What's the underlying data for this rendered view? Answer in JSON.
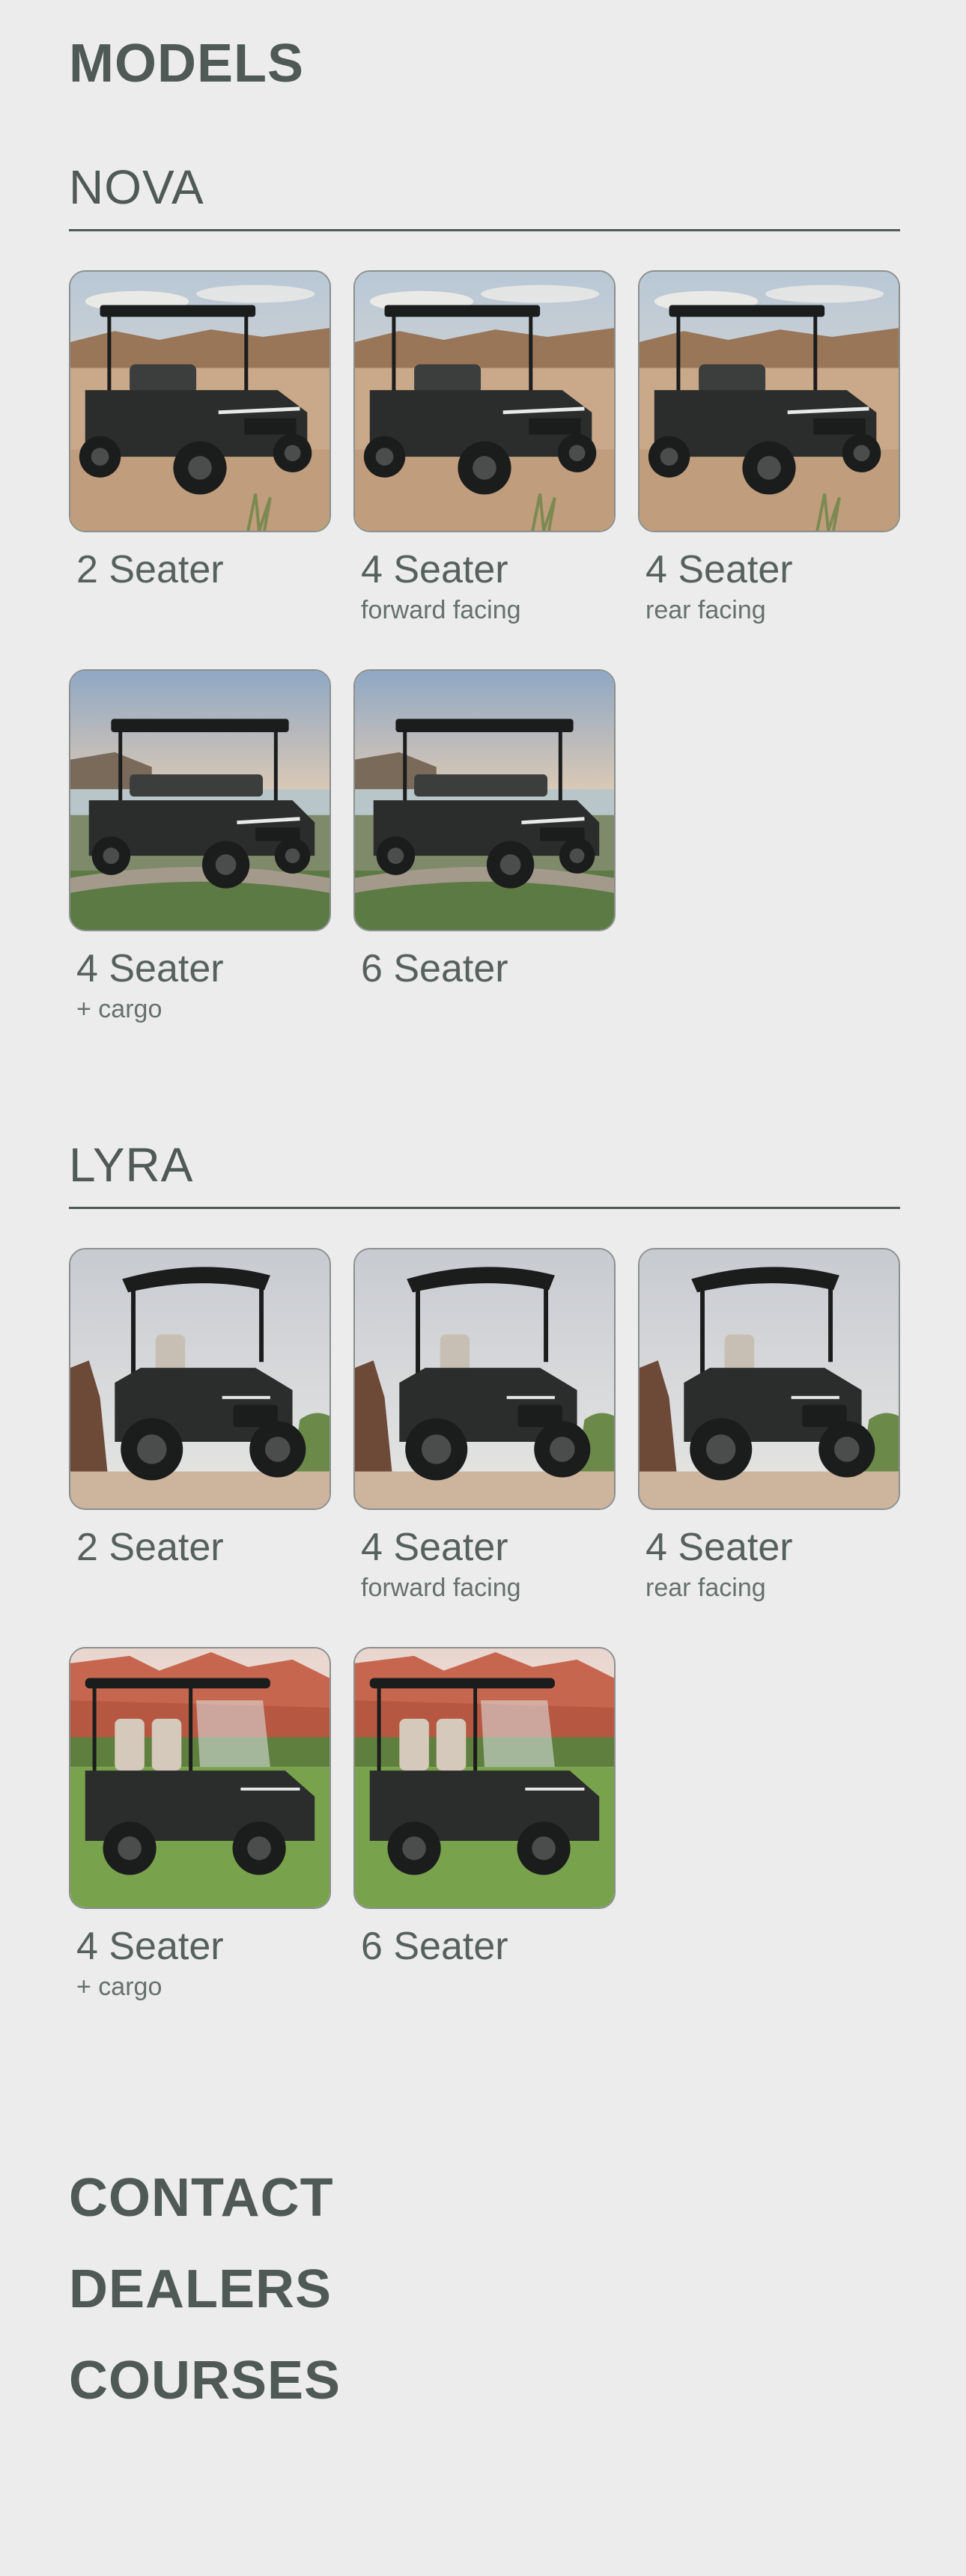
{
  "page": {
    "title": "MODELS"
  },
  "sections": [
    {
      "name": "NOVA",
      "scene": "desert",
      "models": [
        {
          "label": "2 Seater",
          "sub": ""
        },
        {
          "label": "4 Seater",
          "sub": "forward facing"
        },
        {
          "label": "4 Seater",
          "sub": "rear facing"
        },
        {
          "label": "4 Seater",
          "sub": "+ cargo",
          "scene": "coast"
        },
        {
          "label": "6 Seater",
          "sub": "",
          "scene": "coast"
        }
      ]
    },
    {
      "name": "LYRA",
      "scene": "rock",
      "models": [
        {
          "label": "2 Seater",
          "sub": ""
        },
        {
          "label": "4 Seater",
          "sub": "forward facing"
        },
        {
          "label": "4 Seater",
          "sub": "rear facing"
        },
        {
          "label": "4 Seater",
          "sub": "+ cargo",
          "scene": "canyon"
        },
        {
          "label": "6 Seater",
          "sub": "",
          "scene": "canyon"
        }
      ]
    }
  ],
  "nav": {
    "contact": "CONTACT",
    "dealers": "DEALERS",
    "courses": "COURSES"
  },
  "colors": {
    "text": "#4f5956",
    "background": "#ececec",
    "cart": "#2b2d2c"
  }
}
